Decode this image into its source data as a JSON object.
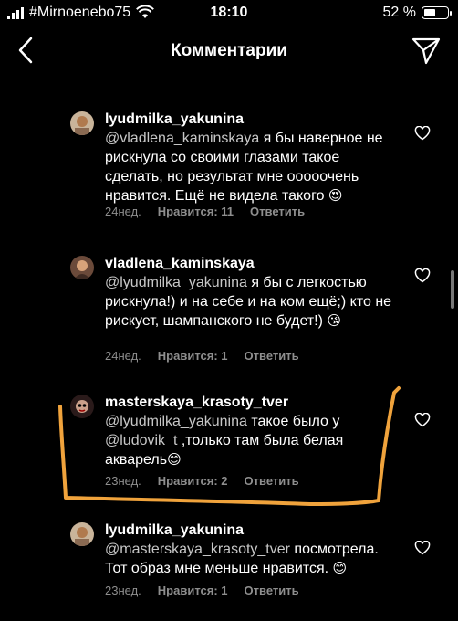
{
  "status_bar": {
    "carrier": "#Mirnoenebo75",
    "time": "18:10",
    "battery": "52 %",
    "battery_level_percent": 52
  },
  "header": {
    "title": "Комментарии"
  },
  "comments": [
    {
      "username": "lyudmilka_yakunina",
      "mention": "@vladlena_kaminskaya",
      "text": " я бы наверное не рискнула со своими глазами такое сделать, но результат мне ооооочень нравится. Ещё не видела такого ",
      "emoji": "😍",
      "time": "24нед.",
      "likes": "Нравится: 11",
      "reply": "Ответить"
    },
    {
      "username": "vladlena_kaminskaya",
      "mention": "@lyudmilka_yakunina",
      "text": " я бы с легкостью рискнула!) и на себе и на ком ещё;) кто не рискует, шампанского не будет!) ",
      "emoji": "😘",
      "time": "24нед.",
      "likes": "Нравится: 1",
      "reply": "Ответить"
    },
    {
      "username": "masterskaya_krasoty_tver",
      "mention": "@lyudmilka_yakunina",
      "text": " такое было у ",
      "mention2": "@ludovik_t",
      "text2": " ,только там была белая акварель",
      "emoji": "😊",
      "time": "23нед.",
      "likes": "Нравится: 2",
      "reply": "Ответить"
    },
    {
      "username": "lyudmilka_yakunina",
      "mention": "@masterskaya_krasoty_tver",
      "text": " посмотрела. Тот образ мне меньше нравится. ",
      "emoji": "😊",
      "time": "23нед.",
      "likes": "Нравится: 1",
      "reply": "Ответить"
    }
  ],
  "colors": {
    "background": "#000000",
    "text": "#ffffff",
    "meta": "#8e8e8e",
    "highlight_stroke": "#f0a33c"
  }
}
